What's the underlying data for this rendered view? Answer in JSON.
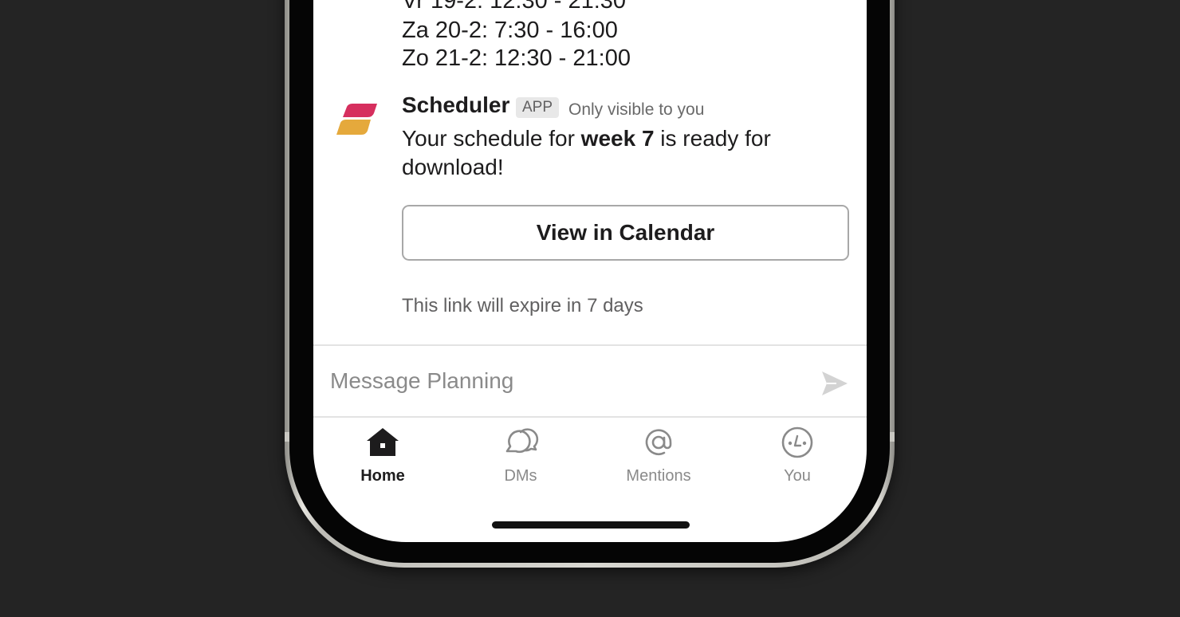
{
  "schedule_lines": [
    "Vr 19-2: 12:30 - 21:30",
    "Za 20-2: 7:30 - 16:00",
    "Zo 21-2: 12:30 - 21:00"
  ],
  "message": {
    "sender": "Scheduler",
    "badge": "APP",
    "visibility": "Only visible to you",
    "text_before": "Your schedule for ",
    "text_bold": "week 7",
    "text_after": " is ready for download!",
    "button_label": "View in Calendar",
    "expiry_note": "This link will expire in 7 days"
  },
  "composer": {
    "placeholder": "Message Planning"
  },
  "tabs": [
    {
      "label": "Home",
      "icon": "home-icon",
      "active": true
    },
    {
      "label": "DMs",
      "icon": "dms-icon",
      "active": false
    },
    {
      "label": "Mentions",
      "icon": "at-sign-icon",
      "active": false
    },
    {
      "label": "You",
      "icon": "avatar-icon",
      "active": false
    }
  ],
  "colors": {
    "background": "#242424",
    "screen": "#ffffff",
    "text": "#1d1c1d",
    "muted": "#8a8a8a",
    "logo_pink": "#d62f5e",
    "logo_gold": "#e5a93c"
  }
}
